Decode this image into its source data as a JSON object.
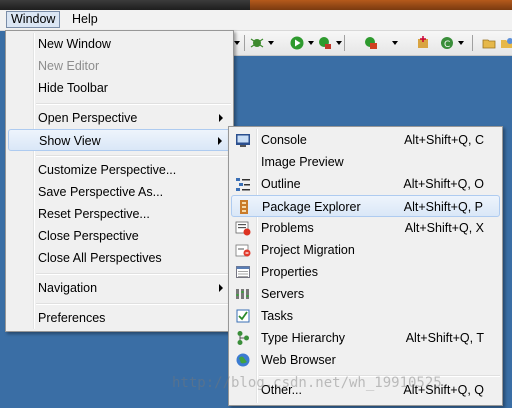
{
  "menubar": {
    "items": [
      {
        "label": "Window"
      },
      {
        "label": "Help"
      }
    ]
  },
  "window_menu": {
    "items": [
      {
        "label": "New Window"
      },
      {
        "label": "New Editor"
      },
      {
        "label": "Hide Toolbar"
      },
      {
        "label": "Open Perspective"
      },
      {
        "label": "Show View"
      },
      {
        "label": "Customize Perspective..."
      },
      {
        "label": "Save Perspective As..."
      },
      {
        "label": "Reset Perspective..."
      },
      {
        "label": "Close Perspective"
      },
      {
        "label": "Close All Perspectives"
      },
      {
        "label": "Navigation"
      },
      {
        "label": "Preferences"
      }
    ]
  },
  "show_view_menu": {
    "items": [
      {
        "label": "Console",
        "shortcut": "Alt+Shift+Q, C",
        "icon": "console-icon"
      },
      {
        "label": "Image Preview",
        "shortcut": "",
        "icon": "image-preview-icon"
      },
      {
        "label": "Outline",
        "shortcut": "Alt+Shift+Q, O",
        "icon": "outline-icon"
      },
      {
        "label": "Package Explorer",
        "shortcut": "Alt+Shift+Q, P",
        "icon": "package-explorer-icon"
      },
      {
        "label": "Problems",
        "shortcut": "Alt+Shift+Q, X",
        "icon": "problems-icon"
      },
      {
        "label": "Project Migration",
        "shortcut": "",
        "icon": "project-migration-icon"
      },
      {
        "label": "Properties",
        "shortcut": "",
        "icon": "properties-icon"
      },
      {
        "label": "Servers",
        "shortcut": "",
        "icon": "servers-icon"
      },
      {
        "label": "Tasks",
        "shortcut": "",
        "icon": "tasks-icon"
      },
      {
        "label": "Type Hierarchy",
        "shortcut": "Alt+Shift+Q, T",
        "icon": "type-hierarchy-icon"
      },
      {
        "label": "Web Browser",
        "shortcut": "",
        "icon": "web-browser-icon"
      },
      {
        "label": "Other...",
        "shortcut": "Alt+Shift+Q, Q",
        "icon": ""
      }
    ]
  },
  "watermark": "http://blog.csdn.net/wh_19910525",
  "colors": {
    "highlight": "#dae7f7",
    "desktop": "#3a6ea5"
  }
}
